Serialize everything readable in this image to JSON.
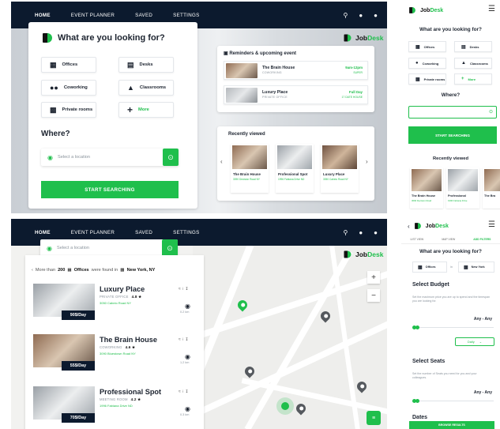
{
  "nav": {
    "items": [
      "HOME",
      "EVENT PLANNER",
      "SAVED",
      "SETTINGS"
    ],
    "icons": [
      "search-icon",
      "notification-icon",
      "user-icon"
    ]
  },
  "brand": {
    "name_a": "Job",
    "name_b": "Desk"
  },
  "home": {
    "question": "What are you looking for?",
    "categories": [
      "Offices",
      "Desks",
      "Coworking",
      "Classrooms",
      "Private rooms",
      "More"
    ],
    "where": "Where?",
    "location_placeholder": "Select a location",
    "start_button": "START SEARCHING"
  },
  "reminders": {
    "title": "Reminders & upcoming event",
    "items": [
      {
        "name": "The Brain House",
        "sub": "COWORKING",
        "time": "9am-12pm",
        "date": "SUPER"
      },
      {
        "name": "Luxury Place",
        "sub": "PRIVATE OFFICE",
        "time": "Full Day",
        "date": "17 DATE HOUSE"
      }
    ]
  },
  "recently_viewed": {
    "title": "Recently viewed",
    "items": [
      {
        "name": "The Brain House",
        "addr": "3090 Decision Road NY"
      },
      {
        "name": "Professional Spot",
        "addr": "1996 Fabiana Drive ND"
      },
      {
        "name": "Luxury Place",
        "addr": "3050 Cabeio Road NY"
      }
    ]
  },
  "mobile_home": {
    "categories": [
      "Offices",
      "Desks",
      "Coworking",
      "Classrooms",
      "Private rooms",
      "More"
    ],
    "recent": [
      {
        "name": "The Brain House",
        "addr": "3090 Decision Road"
      },
      {
        "name": "Professional",
        "addr": "1996 Fabiana Drive"
      },
      {
        "name": "The Bra",
        "addr": ""
      }
    ]
  },
  "results": {
    "prefix": "More than",
    "count": "200",
    "type": "Offices",
    "mid": "were found in",
    "city": "New York, NY",
    "items": [
      {
        "name": "Luxury Place",
        "type": "PRIVATE OFFICE",
        "rating": "4.8 ★",
        "addr": "3050 Cabeio Road NY",
        "price": "90$/Day",
        "dist": "0.2 km"
      },
      {
        "name": "The Brain House",
        "type": "COWORKING",
        "rating": "4.6 ★",
        "addr": "3090 Bluestown Road NY",
        "price": "55$/Day",
        "dist": "1.2 km"
      },
      {
        "name": "Professional Spot",
        "type": "MEETING ROOM",
        "rating": "4.2 ★",
        "addr": "1996 Fabiana Drive ND",
        "price": "70$/Day",
        "dist": "0.3 km"
      }
    ]
  },
  "filters": {
    "tabs": [
      "LIST VIEW",
      "MAP VIEW",
      "ADD FILTERS"
    ],
    "in_word": "in",
    "budget_title": "Select Budget",
    "budget_desc": "Set the maximum price you are up to spend and the timespan you are looking for.",
    "any": "Any - Any",
    "daily": "Daily",
    "seats_title": "Select Seats",
    "seats_desc": "Set the number of Seats you need for you and your colleagues.",
    "dates_title": "Dates",
    "browse": "BROWSE RESULTS"
  },
  "colors": {
    "accent": "#1fbf4c",
    "navy": "#0c1a2e"
  }
}
